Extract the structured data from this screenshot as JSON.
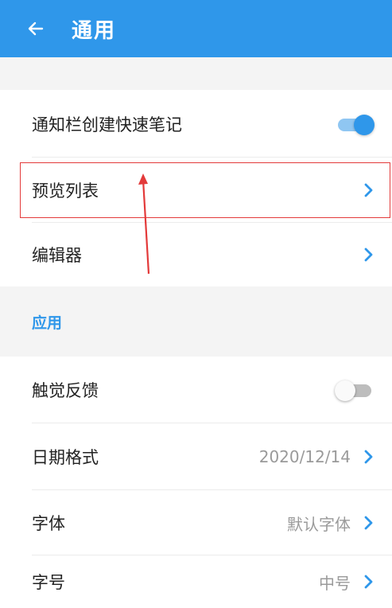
{
  "header": {
    "title": "通用",
    "back_icon": "arrow-left-icon",
    "bg_color": "#2f97ea"
  },
  "settings": {
    "quick_note": {
      "label": "通知栏创建快速笔记",
      "toggle_on": true
    },
    "preview_list": {
      "label": "预览列表"
    },
    "editor": {
      "label": "编辑器"
    }
  },
  "section_app": {
    "title": "应用"
  },
  "app": {
    "haptic": {
      "label": "触觉反馈",
      "toggle_on": false
    },
    "date_format": {
      "label": "日期格式",
      "value": "2020/12/14"
    },
    "font": {
      "label": "字体",
      "value": "默认字体"
    },
    "font_size": {
      "label": "字号",
      "value": "中号"
    }
  },
  "colors": {
    "accent": "#2f97ea",
    "annotation": "#e33a3a"
  }
}
